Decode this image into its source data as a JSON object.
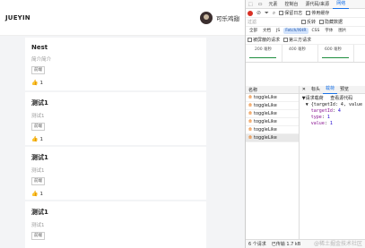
{
  "app": {
    "brand": "JUEYIN",
    "username": "可乐鸡翅",
    "posts": [
      {
        "title": "Nest",
        "desc": "简介简介",
        "tag": "前端",
        "likes": "1"
      },
      {
        "title": "测试1",
        "desc": "测试1",
        "tag": "前端",
        "likes": "1"
      },
      {
        "title": "测试1",
        "desc": "测试1",
        "tag": "前端",
        "likes": "1"
      },
      {
        "title": "测试1",
        "desc": "测试1",
        "tag": "前端",
        "likes": ""
      }
    ]
  },
  "devtools": {
    "tabs": [
      "元素",
      "控制台",
      "源代码/来源",
      "网络"
    ],
    "toolbar": {
      "preserve_log": "保留日志",
      "disable_cache": "停用缓存"
    },
    "filter": {
      "placeholder": "过滤",
      "invert": "反转",
      "hide_data": "隐藏数据"
    },
    "types": [
      "全部",
      "文档",
      "JS",
      "Fetch/XHR",
      "CSS",
      "字体",
      "图片"
    ],
    "blocked": {
      "blocked_requests": "被屏蔽的请求",
      "third_party": "第三方请求"
    },
    "timeline": [
      "200 毫秒",
      "400 毫秒",
      "600 毫秒"
    ],
    "names_header": "名称",
    "requests": [
      "toggleLike",
      "toggleLike",
      "toggleLike",
      "toggleLike",
      "toggleLike",
      "toggleLike"
    ],
    "detail_tabs": [
      "标头",
      "载荷",
      "预览"
    ],
    "payload": {
      "section": "▼请求载荷",
      "view_source": "查看源代码",
      "object": "▼ {targetId: 4, value",
      "target_key": "targetId",
      "target_val": "4",
      "type_key": "type",
      "type_val": "1",
      "value_key": "value",
      "value_val": "1"
    },
    "status": {
      "count": "6 个请求",
      "transferred": "已传输 1.7 kB"
    },
    "watermark": "@稀土掘金技术社区"
  }
}
